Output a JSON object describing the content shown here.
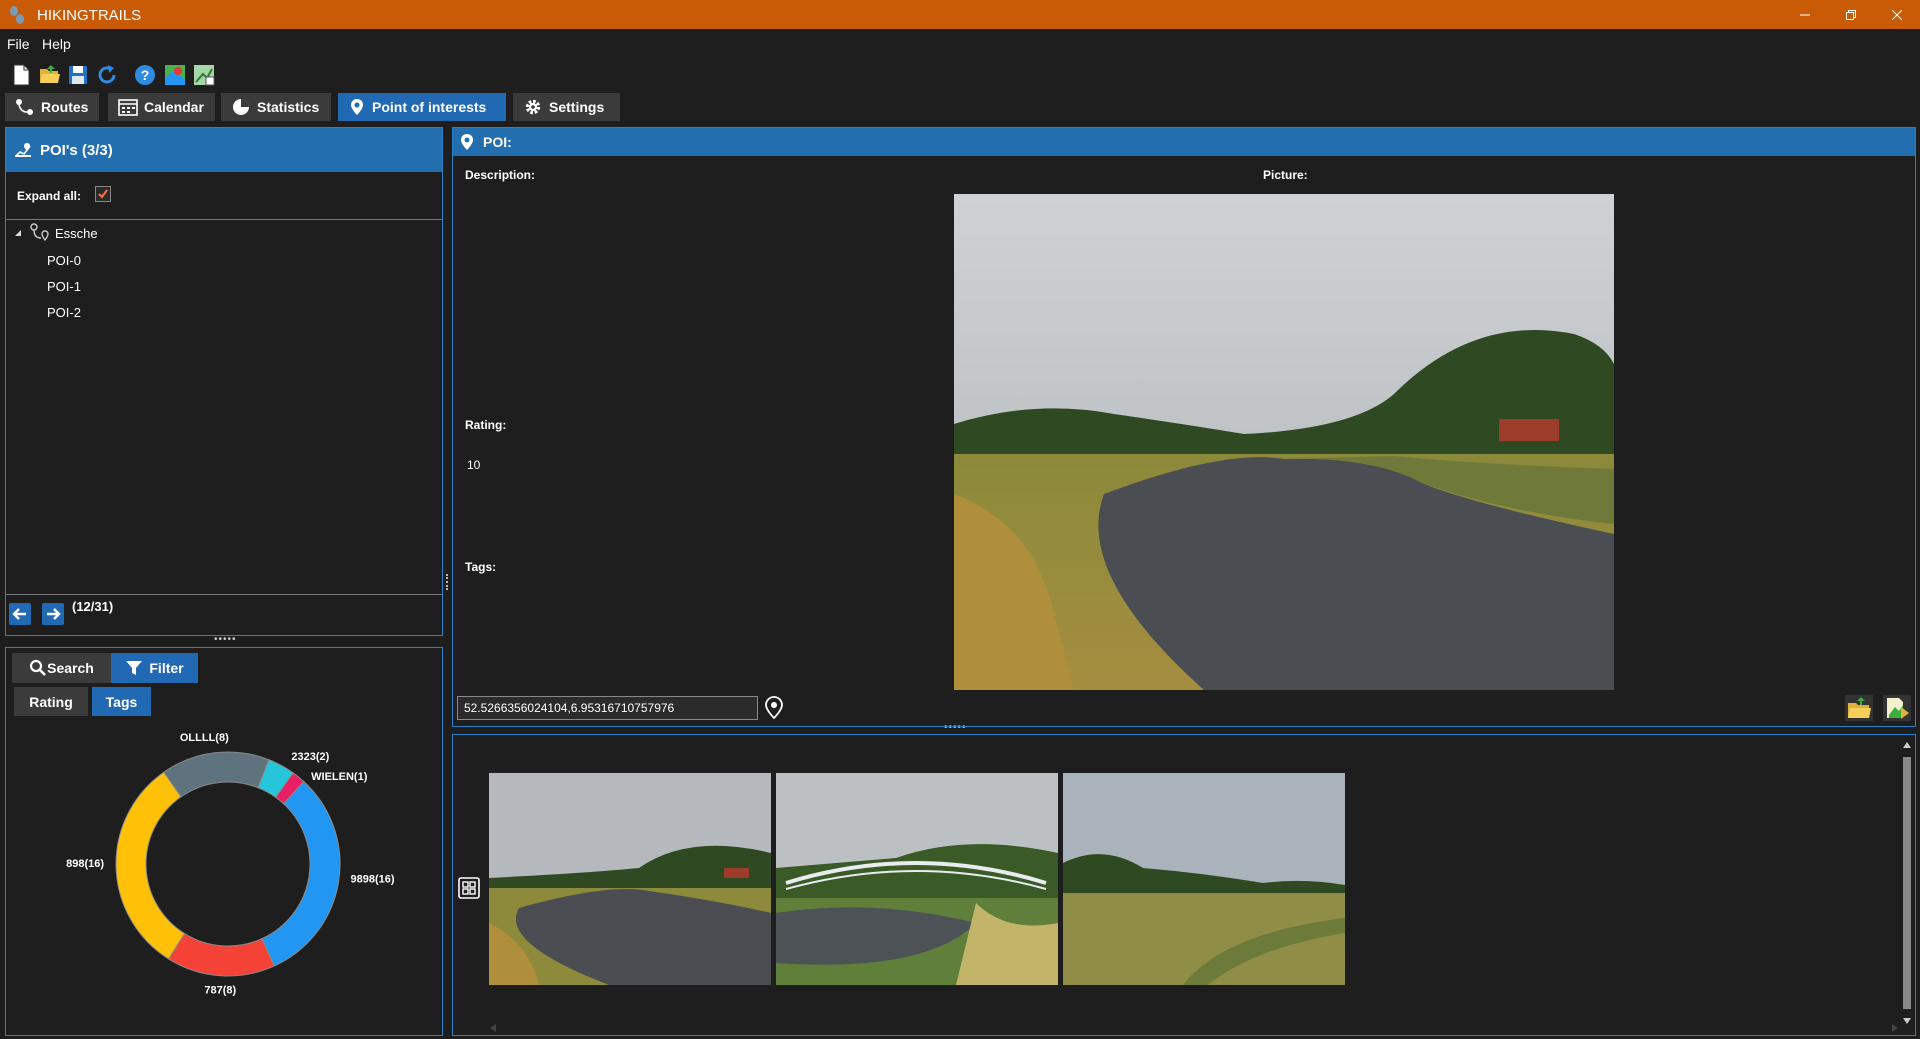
{
  "app": {
    "title": "HIKINGTRAILS"
  },
  "menu": {
    "file": "File",
    "help": "Help"
  },
  "toolbar": {
    "icons": [
      "new-file-icon",
      "open-folder-icon",
      "save-icon",
      "refresh-icon",
      "help-icon",
      "map-icon",
      "map-import-icon"
    ]
  },
  "tabs": [
    {
      "label": "Routes"
    },
    {
      "label": "Calendar"
    },
    {
      "label": "Statistics"
    },
    {
      "label": "Point of interests"
    },
    {
      "label": "Settings"
    }
  ],
  "left_panel": {
    "title": "POI's (3/3)",
    "expand_all_label": "Expand all:",
    "expand_all_checked": true,
    "tree": {
      "root": "Essche",
      "children": [
        "POI-0",
        "POI-1",
        "POI-2"
      ]
    },
    "pager": "(12/31)"
  },
  "filter_panel": {
    "search_label": "Search",
    "filter_label": "Filter",
    "rating_tab": "Rating",
    "tags_tab": "Tags"
  },
  "chart_data": {
    "type": "pie",
    "subtype": "donut",
    "labels": [
      "OLLLL(8)",
      "2323(2)",
      "WIELEN(1)",
      "9898(16)",
      "787(8)",
      "898(16)"
    ],
    "values": [
      8,
      2,
      1,
      16,
      8,
      16
    ],
    "colors": [
      "#5f737e",
      "#26c6da",
      "#e91e63",
      "#2196f3",
      "#f44336",
      "#ffc107"
    ]
  },
  "poi_panel": {
    "title": "POI:",
    "description_label": "Description:",
    "picture_label": "Picture:",
    "rating_label": "Rating:",
    "rating_value": "10",
    "tags_label": "Tags:",
    "coordinates": "52.5266356024104,6.95316710757976"
  },
  "gallery": {
    "thumbnails": [
      "river-thumbnail",
      "bridge-thumbnail",
      "meadow-thumbnail"
    ]
  },
  "colors": {
    "titlebar": "#ca5b06",
    "accent": "#2169b3",
    "background": "#1e1e1e"
  }
}
